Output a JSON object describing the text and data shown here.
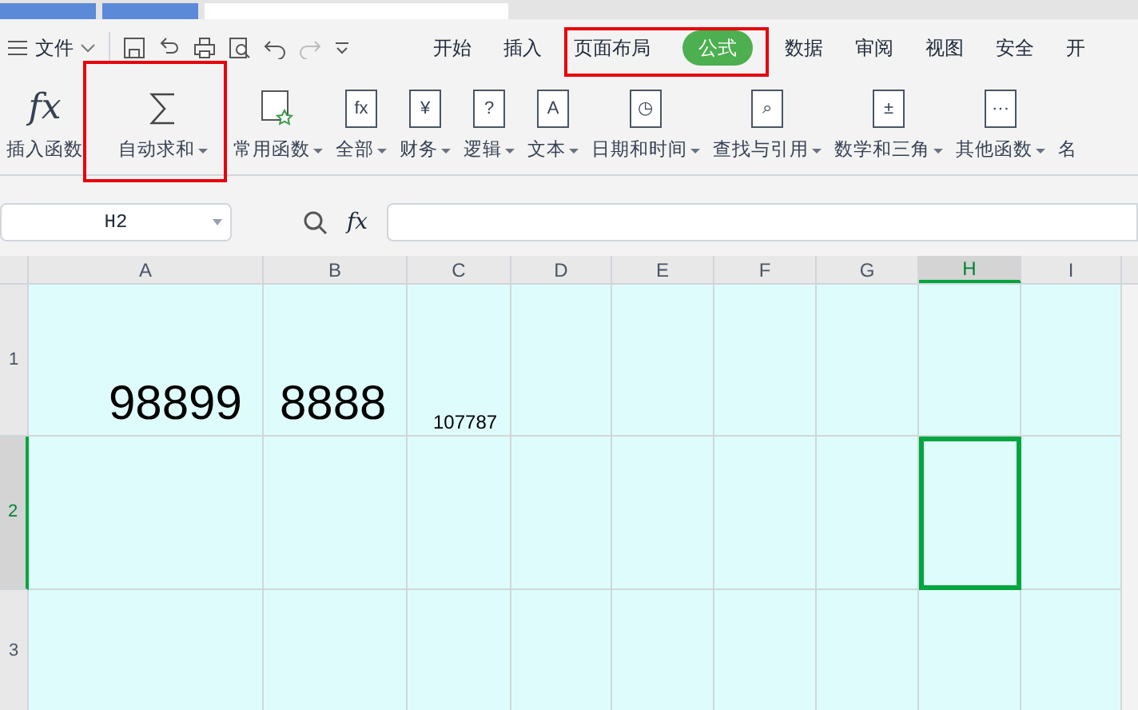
{
  "tabs": [
    {
      "selected": false
    },
    {
      "selected": false
    },
    {
      "selected": true
    }
  ],
  "menu": {
    "file": "文件",
    "items": [
      {
        "label": "开始",
        "selected": false
      },
      {
        "label": "插入",
        "selected": false
      },
      {
        "label": "页面布局",
        "selected": false
      },
      {
        "label": "公式",
        "selected": true
      },
      {
        "label": "数据",
        "selected": false
      },
      {
        "label": "审阅",
        "selected": false
      },
      {
        "label": "视图",
        "selected": false
      },
      {
        "label": "安全",
        "selected": false
      },
      {
        "label": "开",
        "selected": false
      }
    ]
  },
  "ribbon": [
    {
      "kind": "fx",
      "glyph": "fx",
      "label": "插入函数",
      "dropdown": false
    },
    {
      "kind": "sigma",
      "label": "自动求和",
      "dropdown": true
    },
    {
      "kind": "star",
      "label": "常用函数",
      "dropdown": true
    },
    {
      "kind": "book",
      "glyph": "fx",
      "label": "全部",
      "dropdown": true
    },
    {
      "kind": "book",
      "glyph": "¥",
      "label": "财务",
      "dropdown": true
    },
    {
      "kind": "book",
      "glyph": "?",
      "label": "逻辑",
      "dropdown": true
    },
    {
      "kind": "book",
      "glyph": "A",
      "label": "文本",
      "dropdown": true
    },
    {
      "kind": "book",
      "glyph": "◷",
      "label": "日期和时间",
      "dropdown": true
    },
    {
      "kind": "book",
      "glyph": "⌕",
      "label": "查找与引用",
      "dropdown": true
    },
    {
      "kind": "book",
      "glyph": "±",
      "label": "数学和三角",
      "dropdown": true
    },
    {
      "kind": "book",
      "glyph": "···",
      "label": "其他函数",
      "dropdown": true
    },
    {
      "kind": "plain",
      "label": "名",
      "dropdown": false
    }
  ],
  "name_box": "H2",
  "formula_label": "fx",
  "columns": [
    {
      "label": "A",
      "selected": false
    },
    {
      "label": "B",
      "selected": false
    },
    {
      "label": "C",
      "selected": false
    },
    {
      "label": "D",
      "selected": false
    },
    {
      "label": "E",
      "selected": false
    },
    {
      "label": "F",
      "selected": false
    },
    {
      "label": "G",
      "selected": false
    },
    {
      "label": "H",
      "selected": true
    },
    {
      "label": "I",
      "selected": false
    }
  ],
  "rows": [
    {
      "label": "1",
      "selected": false,
      "cells": [
        {
          "text": "98899",
          "kind": "large",
          "selected": false
        },
        {
          "text": "8888",
          "kind": "large",
          "selected": false
        },
        {
          "text": "107787",
          "kind": "small",
          "selected": false
        },
        {
          "selected": false
        },
        {
          "selected": false
        },
        {
          "selected": false
        },
        {
          "selected": false
        },
        {
          "selected": false
        },
        {
          "selected": false
        }
      ]
    },
    {
      "label": "2",
      "selected": true,
      "cells": [
        {
          "selected": false
        },
        {
          "selected": false
        },
        {
          "selected": false
        },
        {
          "selected": false
        },
        {
          "selected": false
        },
        {
          "selected": false
        },
        {
          "selected": false
        },
        {
          "selected": true
        },
        {
          "selected": false
        }
      ]
    },
    {
      "label": "3",
      "selected": false,
      "cells": [
        {
          "selected": false
        },
        {
          "selected": false
        },
        {
          "selected": false
        },
        {
          "selected": false
        },
        {
          "selected": false
        },
        {
          "selected": false
        },
        {
          "selected": false
        },
        {
          "selected": false
        },
        {
          "selected": false
        }
      ]
    }
  ]
}
